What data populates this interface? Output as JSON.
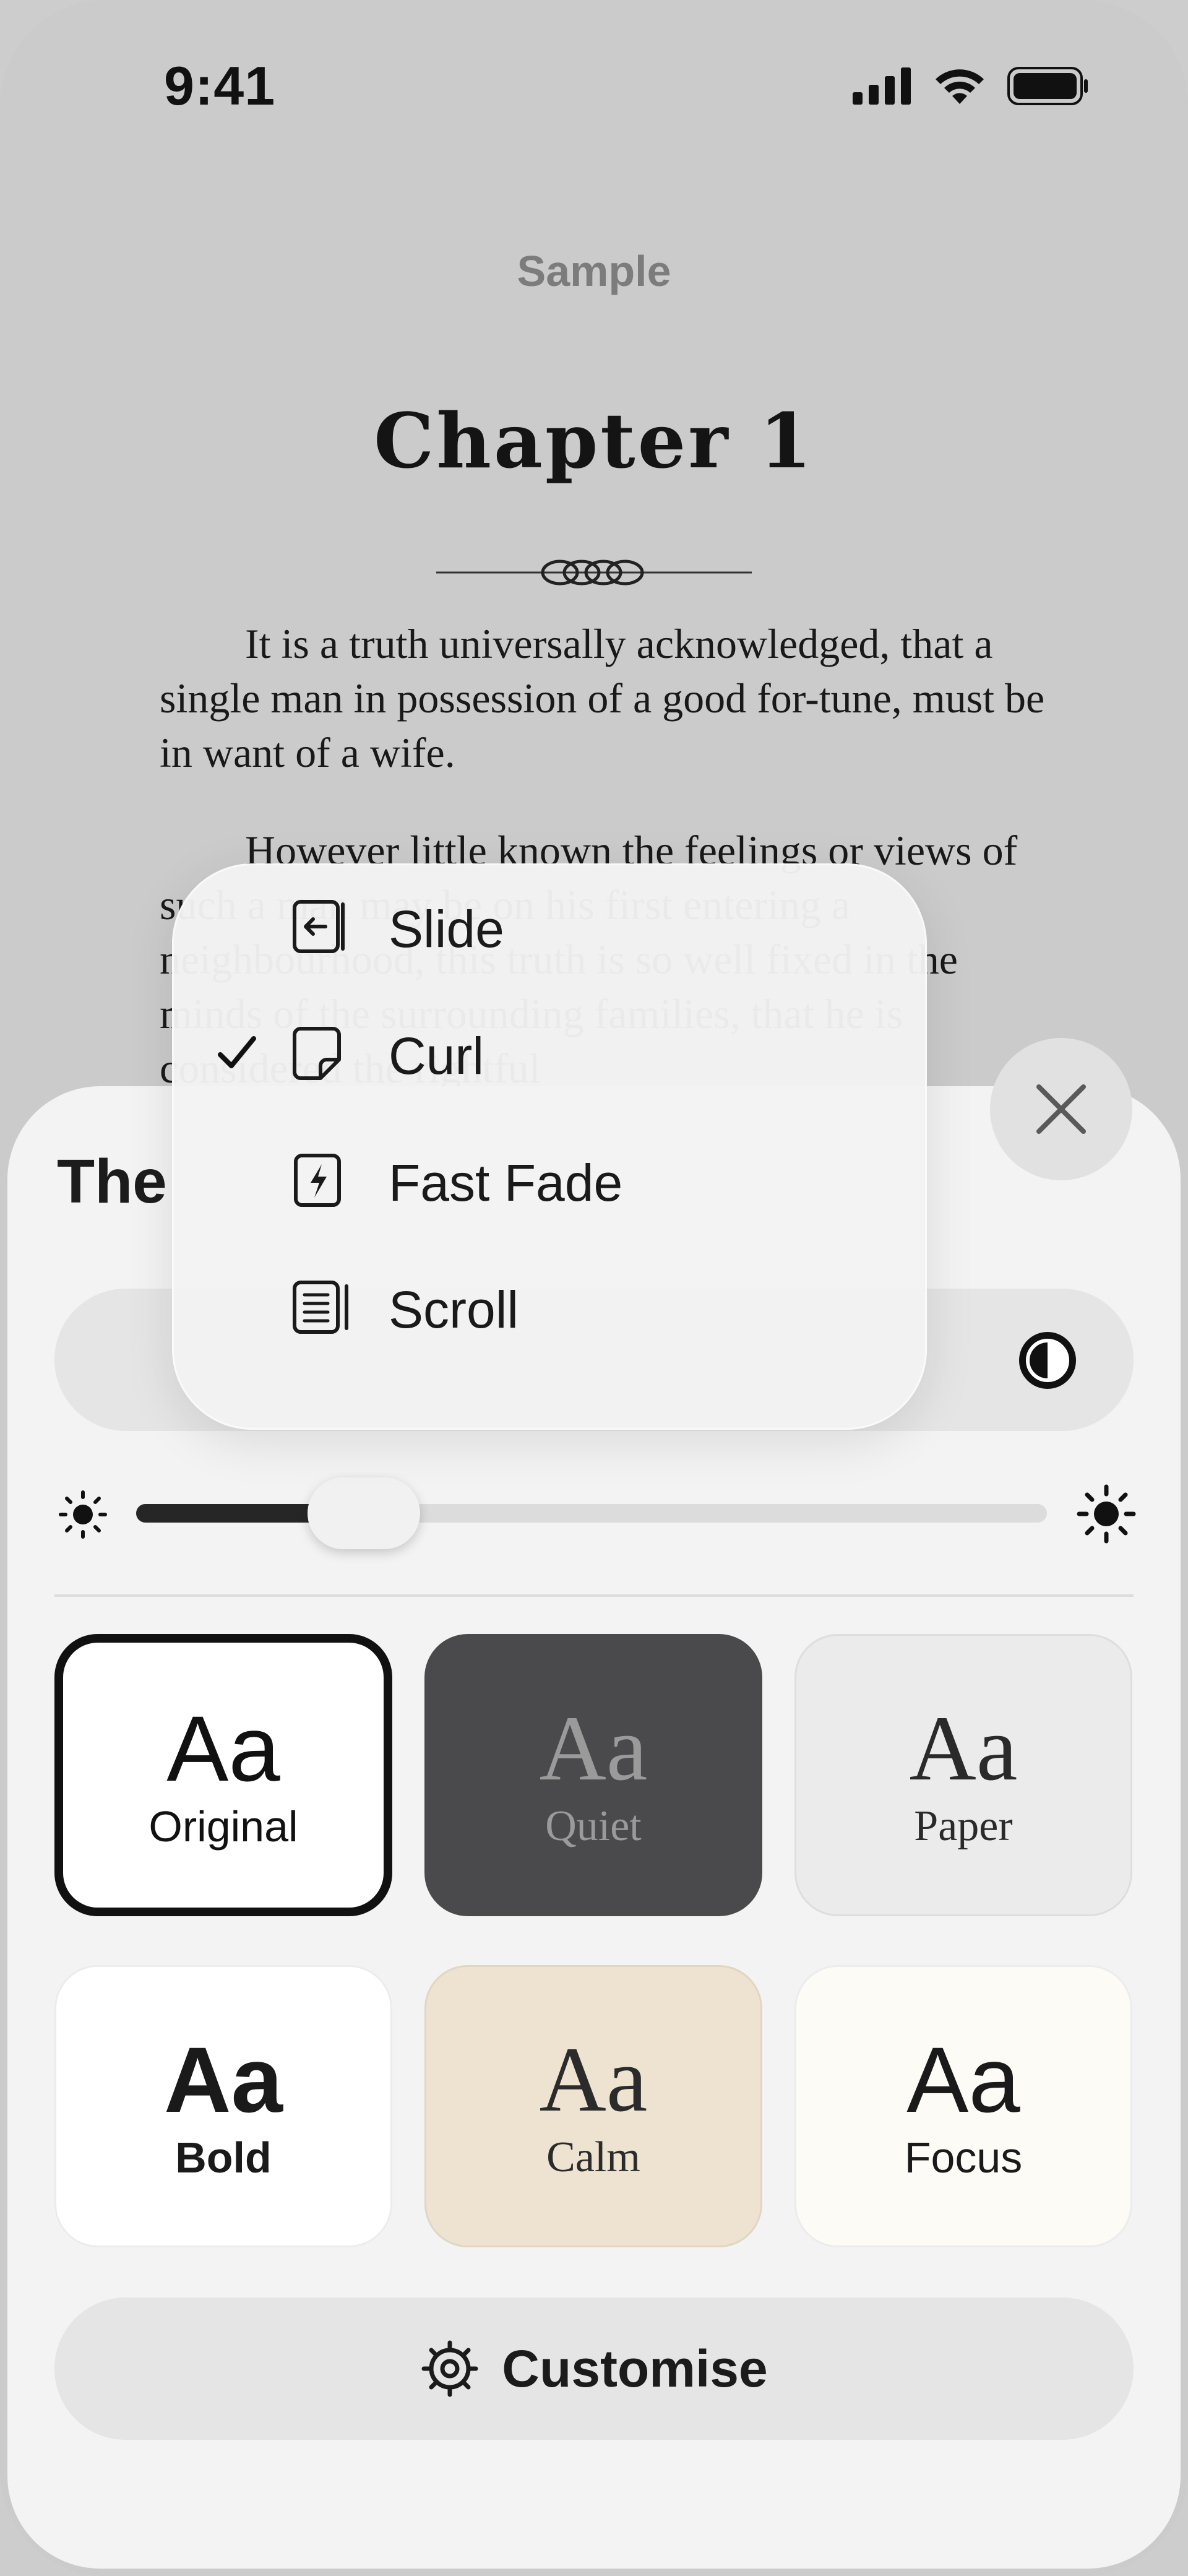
{
  "status_bar": {
    "time": "9:41"
  },
  "book": {
    "title": "Sample",
    "chapter": "Chapter 1",
    "paragraphs": [
      "It is a truth universally acknowledged, that a single man in possession of a good for-tune, must be in want of a wife.",
      "However little known the feelings or views of such a man may be on his first entering a neighbourhood, this truth is so well fixed in the minds of the surrounding families, that he is considered the rightful"
    ]
  },
  "sheet": {
    "title": "The",
    "brightness": 0.25,
    "themes": [
      {
        "aa": "Aa",
        "label": "Original",
        "selected": true
      },
      {
        "aa": "Aa",
        "label": "Quiet"
      },
      {
        "aa": "Aa",
        "label": "Paper"
      },
      {
        "aa": "Aa",
        "label": "Bold"
      },
      {
        "aa": "Aa",
        "label": "Calm"
      },
      {
        "aa": "Aa",
        "label": "Focus"
      }
    ],
    "customise_label": "Customise"
  },
  "menu": {
    "items": [
      {
        "label": "Slide",
        "icon": "slide-icon",
        "checked": false
      },
      {
        "label": "Curl",
        "icon": "curl-icon",
        "checked": true
      },
      {
        "label": "Fast Fade",
        "icon": "fast-fade-icon",
        "checked": false
      },
      {
        "label": "Scroll",
        "icon": "scroll-icon",
        "checked": false
      }
    ]
  }
}
